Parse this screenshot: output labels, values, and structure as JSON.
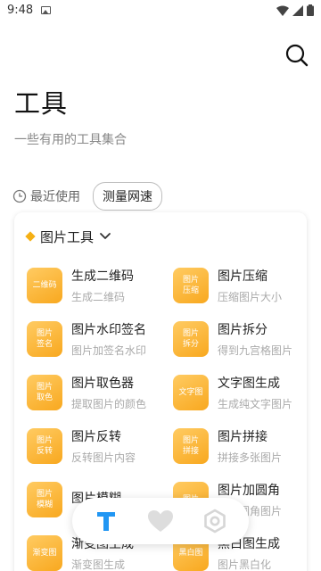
{
  "status_bar": {
    "time": "9:48"
  },
  "header": {
    "title": "工具",
    "subtitle": "一些有用的工具集合"
  },
  "recent": {
    "label": "最近使用",
    "chips": [
      "测量网速"
    ]
  },
  "section": {
    "title": "图片工具"
  },
  "tools": [
    {
      "icon_text": "二维码",
      "name": "生成二维码",
      "desc": "生成二维码"
    },
    {
      "icon_text": "图片\n压缩",
      "name": "图片压缩",
      "desc": "压缩图片大小"
    },
    {
      "icon_text": "图片\n签名",
      "name": "图片水印签名",
      "desc": "图片加签名水印"
    },
    {
      "icon_text": "图片\n拆分",
      "name": "图片拆分",
      "desc": "得到九宫格图片"
    },
    {
      "icon_text": "图片\n取色",
      "name": "图片取色器",
      "desc": "提取图片的颜色"
    },
    {
      "icon_text": "文字图",
      "name": "文字图生成",
      "desc": "生成纯文字图片"
    },
    {
      "icon_text": "图片\n反转",
      "name": "图片反转",
      "desc": "反转图片内容"
    },
    {
      "icon_text": "图片\n拼接",
      "name": "图片拼接",
      "desc": "拼接多张图片"
    },
    {
      "icon_text": "图片\n模糊",
      "name": "图片模糊",
      "desc": ""
    },
    {
      "icon_text": "图片",
      "name": "图片加圆角",
      "desc": "图片圆角图片"
    },
    {
      "icon_text": "渐变图",
      "name": "渐变图生成",
      "desc": "渐变图生成"
    },
    {
      "icon_text": "黑白图",
      "name": "黑白图生成",
      "desc": "图片黑白化"
    }
  ],
  "bottom_nav": {
    "items": [
      "tools-icon",
      "heart-icon",
      "settings-icon"
    ],
    "active": "tools-icon"
  },
  "colors": {
    "accent": "#2196f3",
    "tool_icon": "#f8a81f",
    "diamond": "#f5b014"
  }
}
